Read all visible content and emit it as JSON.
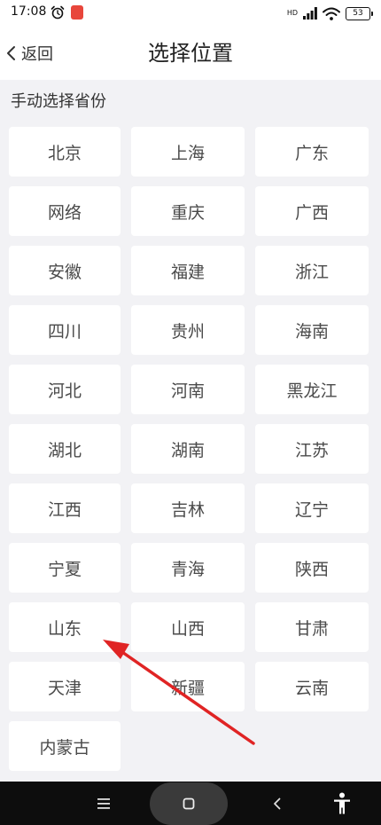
{
  "status_bar": {
    "time": "17:08",
    "network": "HD",
    "battery": "53"
  },
  "header": {
    "back_label": "返回",
    "title": "选择位置"
  },
  "section": {
    "title": "手动选择省份"
  },
  "provinces": [
    "北京",
    "上海",
    "广东",
    "网络",
    "重庆",
    "广西",
    "安徽",
    "福建",
    "浙江",
    "四川",
    "贵州",
    "海南",
    "河北",
    "河南",
    "黑龙江",
    "湖北",
    "湖南",
    "江苏",
    "江西",
    "吉林",
    "辽宁",
    "宁夏",
    "青海",
    "陕西",
    "山东",
    "山西",
    "甘肃",
    "天津",
    "新疆",
    "云南",
    "内蒙古"
  ],
  "colors": {
    "page_background": "#f2f2f5",
    "card_background": "#ffffff",
    "arrow": "#e02424",
    "nav_bar": "#0d0d0d"
  },
  "icons": {
    "alarm": "alarm-clock-icon",
    "notification": "app-badge-icon",
    "signal": "signal-bars-icon",
    "wifi": "wifi-icon",
    "back": "chevron-left-icon",
    "menu": "menu-lines-icon",
    "home": "home-square-icon",
    "nav_back": "nav-back-icon",
    "accessibility": "accessibility-icon"
  }
}
